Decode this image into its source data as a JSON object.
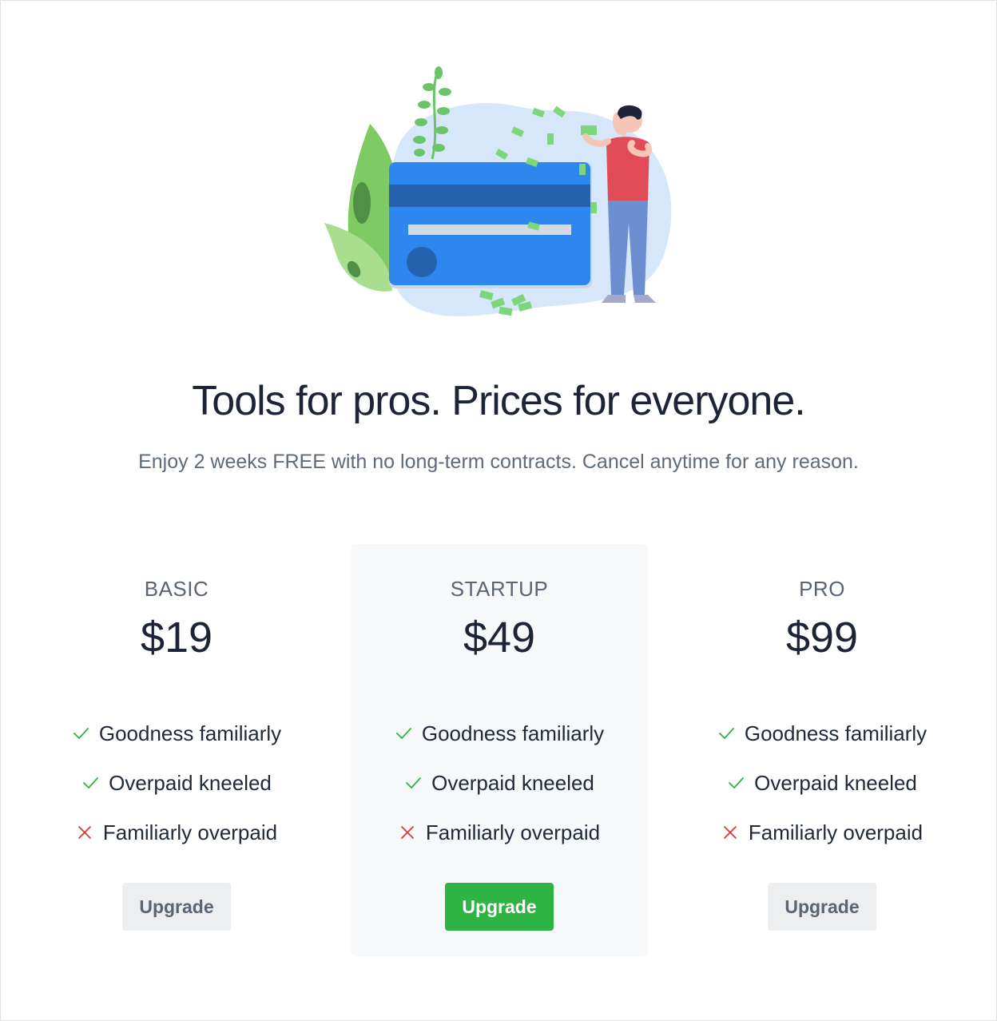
{
  "hero": {
    "illustration": "person-with-credit-card-and-money-illustration"
  },
  "header": {
    "title": "Tools for pros. Prices for everyone.",
    "subtitle": "Enjoy 2 weeks FREE with no long-term contracts. Cancel anytime for any reason."
  },
  "colors": {
    "accent": "#2fb344",
    "check": "#2fb344",
    "cross": "#d63939",
    "featured_bg": "#f7f8f9"
  },
  "plans": [
    {
      "name": "BASIC",
      "price": "$19",
      "featured": false,
      "features": [
        {
          "label": "Goodness familiarly",
          "included": true,
          "icon": "check-icon"
        },
        {
          "label": "Overpaid kneeled",
          "included": true,
          "icon": "check-icon"
        },
        {
          "label": "Familiarly overpaid",
          "included": false,
          "icon": "cross-icon"
        }
      ],
      "button_label": "Upgrade"
    },
    {
      "name": "STARTUP",
      "price": "$49",
      "featured": true,
      "features": [
        {
          "label": "Goodness familiarly",
          "included": true,
          "icon": "check-icon"
        },
        {
          "label": "Overpaid kneeled",
          "included": true,
          "icon": "check-icon"
        },
        {
          "label": "Familiarly overpaid",
          "included": false,
          "icon": "cross-icon"
        }
      ],
      "button_label": "Upgrade"
    },
    {
      "name": "PRO",
      "price": "$99",
      "featured": false,
      "features": [
        {
          "label": "Goodness familiarly",
          "included": true,
          "icon": "check-icon"
        },
        {
          "label": "Overpaid kneeled",
          "included": true,
          "icon": "check-icon"
        },
        {
          "label": "Familiarly overpaid",
          "included": false,
          "icon": "cross-icon"
        }
      ],
      "button_label": "Upgrade"
    }
  ]
}
